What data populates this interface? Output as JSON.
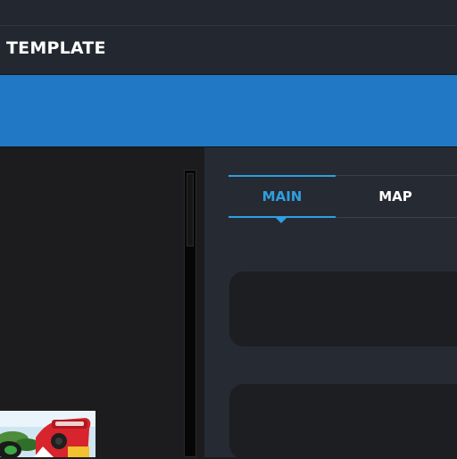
{
  "header": {
    "title": "TEMPLATE"
  },
  "tabs": [
    {
      "label": "MAIN",
      "active": true
    },
    {
      "label": "MAP",
      "active": false
    }
  ],
  "colors": {
    "accent": "#2f9fe0",
    "banner": "#2179c5",
    "header_bg": "#222730",
    "panel_bg": "#262a33",
    "card_bg": "#1c1e22"
  },
  "thumbnail": {
    "icon": "racing-game-thumbnail"
  }
}
